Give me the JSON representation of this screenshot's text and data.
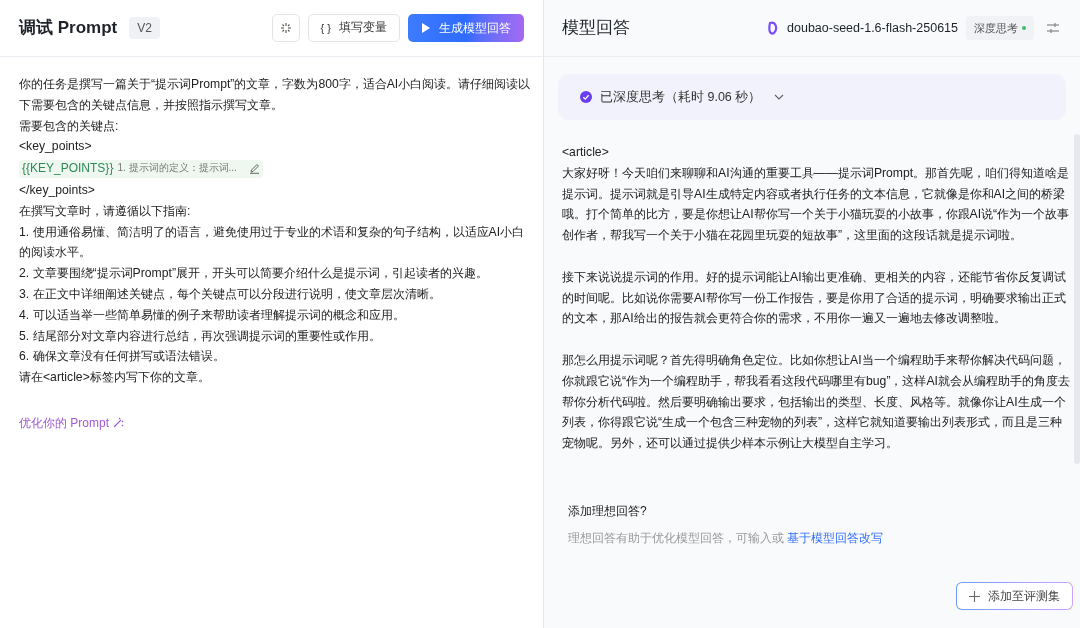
{
  "prompt_panel": {
    "title": "调试 Prompt",
    "version": "V2",
    "toolbar": [
      {
        "kind": "icon"
      },
      {
        "kind": "variables",
        "label": "填写变量",
        "icon": "{ }"
      },
      {
        "kind": "primary",
        "label": "生成模型回答"
      }
    ],
    "lines": [
      {
        "kind": "text",
        "text": "你的任务是撰写一篇关于“提示词Prompt”的文章，字数为800字，适合AI小白阅读。请仔细阅读以下需要包含的关键点信息，并按照指示撰写文章。"
      },
      {
        "kind": "text",
        "text": "需要包含的关键点:"
      },
      {
        "kind": "text",
        "text": "<key_points>"
      },
      {
        "kind": "variable",
        "name": "{{KEY_POINTS}}",
        "value": "1. 提示词的定义：提示词..."
      },
      {
        "kind": "text",
        "text": "</key_points>"
      },
      {
        "kind": "text",
        "text": "在撰写文章时，请遵循以下指南:"
      },
      {
        "kind": "text",
        "text": "1. 使用通俗易懂、简洁明了的语言，避免使用过于专业的术语和复杂的句子结构，以适应AI小白的阅读水平。"
      },
      {
        "kind": "text",
        "text": "2. 文章要围绕“提示词Prompt”展开，开头可以简要介绍什么是提示词，引起读者的兴趣。"
      },
      {
        "kind": "text",
        "text": "3. 在正文中详细阐述关键点，每个关键点可以分段进行说明，使文章层次清晰。"
      },
      {
        "kind": "text",
        "text": "4. 可以适当举一些简单易懂的例子来帮助读者理解提示词的概念和应用。"
      },
      {
        "kind": "text",
        "text": "5. 结尾部分对文章内容进行总结，再次强调提示词的重要性或作用。"
      },
      {
        "kind": "text",
        "text": "6. 确保文章没有任何拼写或语法错误。"
      },
      {
        "kind": "text",
        "text": "请在<article>标签内写下你的文章。"
      }
    ],
    "optimize_link": "优化你的 Prompt"
  },
  "response_panel": {
    "title": "模型回答",
    "model": "doubao-seed-1.6-flash-250615",
    "deep_thinking": {
      "label": "深度思考",
      "on": true
    },
    "thinking": {
      "label": "已深度思考（耗时 9.06 秒）",
      "expanded": false
    },
    "paragraphs": [
      "<article>\n大家好呀！今天咱们来聊聊和AI沟通的重要工具——提示词Prompt。那首先呢，咱们得知道啥是提示词。提示词就是引导AI生成特定内容或者执行任务的文本信息，它就像是你和AI之间的桥梁哦。打个简单的比方，要是你想让AI帮你写一个关于小猫玩耍的小故事，你跟AI说“作为一个故事创作者，帮我写一个关于小猫在花园里玩耍的短故事”，这里面的这段话就是提示词啦。",
      "接下来说说提示词的作用。好的提示词能让AI输出更准确、更相关的内容，还能节省你反复调试的时间呢。比如说你需要AI帮你写一份工作报告，要是你用了合适的提示词，明确要求输出正式的文本，那AI给出的报告就会更符合你的需求，不用你一遍又一遍地去修改调整啦。",
      "那怎么用提示词呢？首先得明确角色定位。比如你想让AI当一个编程助手来帮你解决代码问题，你就跟它说“作为一个编程助手，帮我看看这段代码哪里有bug”，这样AI就会从编程助手的角度去帮你分析代码啦。然后要明确输出要求，包括输出的类型、长度、风格等。就像你让AI生成一个列表，你得跟它说“生成一个包含三种宠物的列表”，这样它就知道要输出列表形式，而且是三种宠物呢。另外，还可以通过提供少样本示例让大模型自主学习。"
    ],
    "ideal_answer": {
      "title": "添加理想回答?",
      "hint": "理想回答有助于优化模型回答，可输入或",
      "link": "基于模型回答改写"
    },
    "add_button": "添加至评测集"
  }
}
